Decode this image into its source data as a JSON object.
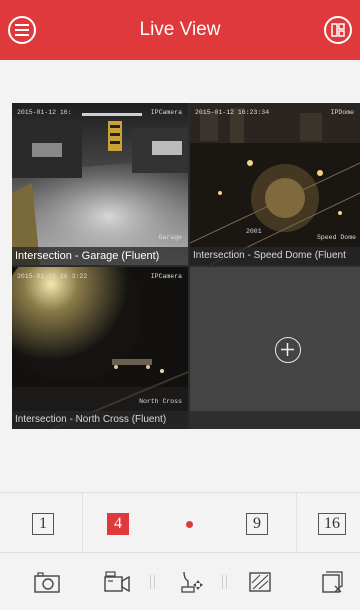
{
  "header": {
    "title": "Live View",
    "menu_icon": "menu-icon",
    "layout_icon": "device-list-icon",
    "accent": "#e0393c"
  },
  "panes": [
    {
      "caption": "Intersection - Garage (Fluent)",
      "timestamp": "2015-01-12 16:",
      "camera": "IPCamera",
      "overlay": "Garage",
      "active": true
    },
    {
      "caption": "Intersection - Speed Dome (Fluent",
      "timestamp": "2015-01-12 16:23:34",
      "camera": "IPDome",
      "overlay": "Speed Dome",
      "overlay2": "2001"
    },
    {
      "caption": "Intersection - North Cross (Fluent)",
      "timestamp": "2015-01-12 16 3:22",
      "camera": "IPCamera",
      "overlay": "North Cross"
    },
    {
      "caption": "",
      "empty": true,
      "add_icon": "add-camera-icon"
    }
  ],
  "layout_options": {
    "one": "1",
    "four": "4",
    "nine": "9",
    "sixteen": "16",
    "selected": "4"
  },
  "toolbar": {
    "icons": [
      "capture-icon",
      "record-icon",
      "ptz-icon",
      "quality-icon",
      "close-all-icon"
    ]
  }
}
